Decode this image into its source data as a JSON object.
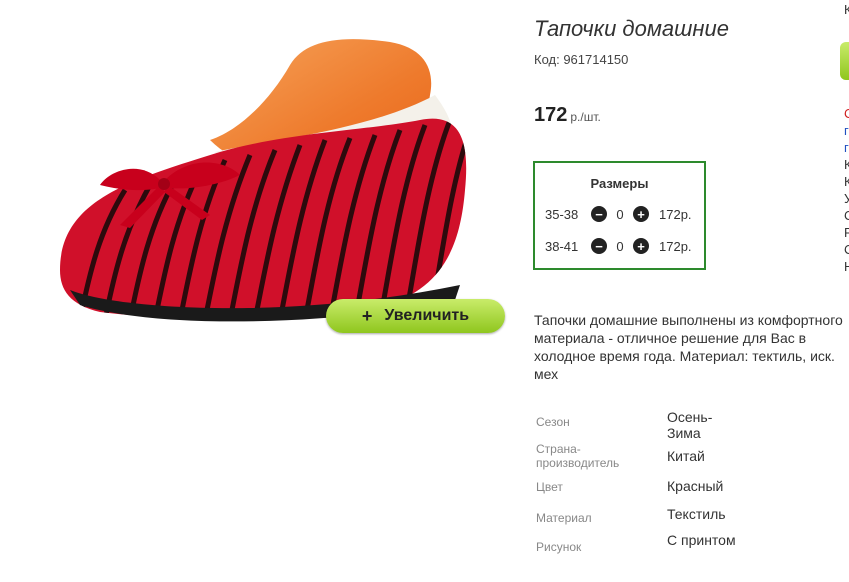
{
  "product": {
    "title": "Тапочки домашние",
    "code": "Код: 961714150",
    "price": "172",
    "price_unit": "р./шт.",
    "zoom_label": "Увеличить",
    "zoom_icon": "plus-icon",
    "description": "Тапочки домашние выполнены из комфортного материала - отличное решение для Вас в холодное время года. Материал: тектиль, иск. мех"
  },
  "sizes": {
    "title": "Размеры",
    "rows": [
      {
        "label": "35-38",
        "qty": "0",
        "price": "172р."
      },
      {
        "label": "38-41",
        "qty": "0",
        "price": "172р."
      }
    ]
  },
  "properties": [
    {
      "key": "Сезон",
      "value": "Осень-Зима"
    },
    {
      "key": "Страна-производитель",
      "value": "Китай"
    },
    {
      "key": "Цвет",
      "value": "Красный"
    },
    {
      "key": "Материал",
      "value": "Текстиль"
    },
    {
      "key": "Рисунок",
      "value": "С принтом"
    }
  ],
  "right_edge_glyphs": [
    "К",
    "С",
    "г",
    "г",
    "К",
    "К",
    "У",
    "С",
    "Р",
    "С",
    "Н"
  ],
  "colors": {
    "accent_green": "#8fc61e",
    "box_border": "#2d8a2d",
    "slipper_red": "#d0102a"
  }
}
